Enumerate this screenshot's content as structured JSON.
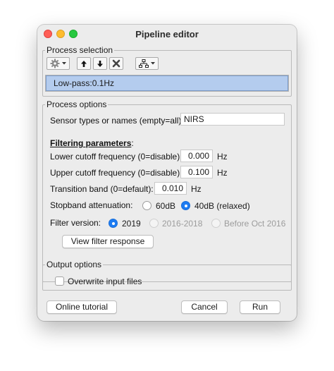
{
  "window": {
    "title": "Pipeline editor"
  },
  "process_selection": {
    "legend": "Process selection",
    "toolbar": {
      "settings_icon": "gear-icon",
      "move_up_icon": "arrow-up-icon",
      "move_down_icon": "arrow-down-icon",
      "delete_icon": "delete-x-icon",
      "tree_icon": "tree-icon"
    },
    "items": [
      "Low-pass:0.1Hz"
    ]
  },
  "process_options": {
    "legend": "Process options",
    "sensor_label": "Sensor types or names (empty=all):",
    "sensor_value": "NIRS",
    "filtering_heading": "Filtering parameters",
    "filtering_colon": ":",
    "lower_label": "Lower cutoff frequency (0=disable):",
    "lower_value": "0.000",
    "lower_unit": "Hz",
    "upper_label": "Upper cutoff frequency (0=disable):",
    "upper_value": "0.100",
    "upper_unit": "Hz",
    "transition_label": "Transition band (0=default):",
    "transition_value": "0.010",
    "transition_unit": "Hz",
    "stopband_label": "Stopband attenuation:",
    "stopband_options": [
      "60dB",
      "40dB (relaxed)"
    ],
    "stopband_selected": "40dB (relaxed)",
    "filter_version_label": "Filter version:",
    "filter_version_options": [
      "2019",
      "2016-2018",
      "Before Oct 2016"
    ],
    "filter_version_selected": "2019",
    "view_response_button": "View filter response"
  },
  "output_options": {
    "legend": "Output options",
    "overwrite_label": "Overwrite input files",
    "overwrite_checked": false
  },
  "footer": {
    "tutorial_button": "Online tutorial",
    "cancel_button": "Cancel",
    "run_button": "Run"
  },
  "colors": {
    "selected_item_bg": "#b4ccee",
    "radio_selected": "#1d7cf2",
    "close": "#ff5f57",
    "minimize": "#febc2e",
    "zoom": "#28c840"
  }
}
